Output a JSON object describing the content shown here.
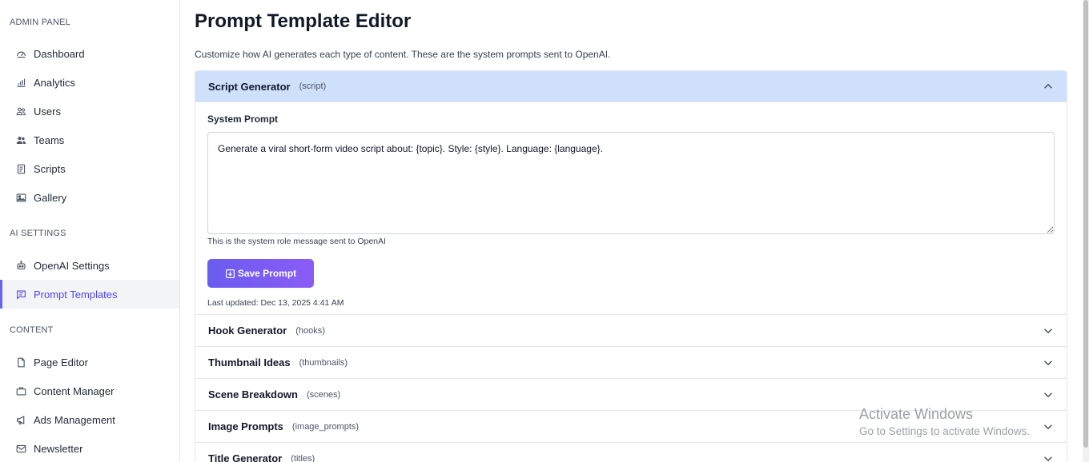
{
  "sidebar": {
    "sections": [
      {
        "title": "ADMIN PANEL"
      },
      {
        "title": "AI SETTINGS"
      },
      {
        "title": "CONTENT"
      }
    ],
    "items": [
      {
        "label": "Dashboard",
        "icon": "dashboard-icon"
      },
      {
        "label": "Analytics",
        "icon": "analytics-icon"
      },
      {
        "label": "Users",
        "icon": "users-icon"
      },
      {
        "label": "Teams",
        "icon": "teams-icon"
      },
      {
        "label": "Scripts",
        "icon": "scripts-icon"
      },
      {
        "label": "Gallery",
        "icon": "gallery-icon"
      },
      {
        "label": "OpenAI Settings",
        "icon": "robot-icon"
      },
      {
        "label": "Prompt Templates",
        "icon": "message-icon",
        "active": true
      },
      {
        "label": "Page Editor",
        "icon": "page-icon"
      },
      {
        "label": "Content Manager",
        "icon": "briefcase-icon"
      },
      {
        "label": "Ads Management",
        "icon": "megaphone-icon"
      },
      {
        "label": "Newsletter",
        "icon": "mail-icon"
      }
    ]
  },
  "main": {
    "title": "Prompt Template Editor",
    "description": "Customize how AI generates each type of content. These are the system prompts sent to OpenAI.",
    "templates": [
      {
        "name": "Script Generator",
        "key": "(script)",
        "open": true
      },
      {
        "name": "Hook Generator",
        "key": "(hooks)"
      },
      {
        "name": "Thumbnail Ideas",
        "key": "(thumbnails)"
      },
      {
        "name": "Scene Breakdown",
        "key": "(scenes)"
      },
      {
        "name": "Image Prompts",
        "key": "(image_prompts)"
      },
      {
        "name": "Title Generator",
        "key": "(titles)"
      }
    ],
    "editor": {
      "label": "System Prompt",
      "value": "Generate a viral short-form video script about: {topic}. Style: {style}. Language: {language}.",
      "hint": "This is the system role message sent to OpenAI",
      "save_label": "Save Prompt",
      "last_updated": "Last updated: Dec 13, 2025 4:41 AM"
    }
  },
  "watermark": {
    "line1": "Activate Windows",
    "line2": "Go to Settings to activate Windows."
  },
  "colors": {
    "accent": "#6366f1",
    "open_header_bg": "#cfe0fb",
    "button_gradient_start": "#6a5cf0",
    "button_gradient_end": "#8b5cf6"
  }
}
